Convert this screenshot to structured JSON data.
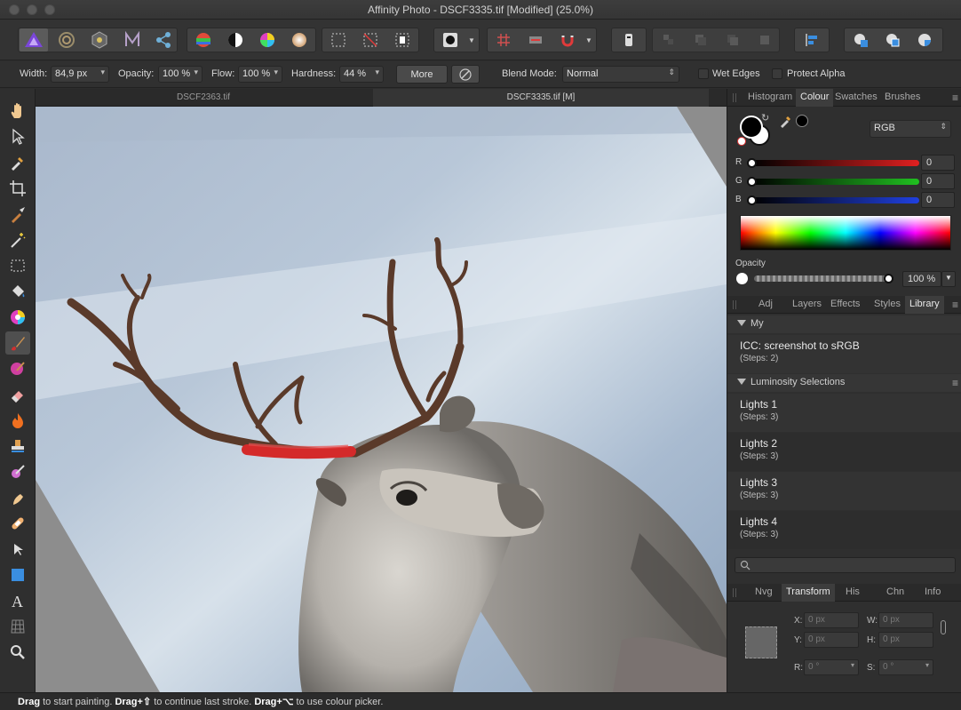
{
  "window": {
    "title": "Affinity Photo - DSCF3335.tif [Modified] (25.0%)"
  },
  "context_bar": {
    "width_label": "Width:",
    "width_value": "84,9 px",
    "opacity_label": "Opacity:",
    "opacity_value": "100 %",
    "flow_label": "Flow:",
    "flow_value": "100 %",
    "hardness_label": "Hardness:",
    "hardness_value": "44 %",
    "more_label": "More",
    "blend_label": "Blend Mode:",
    "blend_value": "Normal",
    "wet_edges_label": "Wet Edges",
    "protect_alpha_label": "Protect Alpha"
  },
  "doc_tabs": [
    {
      "label": "DSCF2363.tif"
    },
    {
      "label": "DSCF3335.tif [M]"
    }
  ],
  "colour_panel": {
    "tabs": [
      "Histogram",
      "Colour",
      "Swatches",
      "Brushes"
    ],
    "active_tab": "Colour",
    "model": "RGB",
    "r_label": "R",
    "r_value": "0",
    "g_label": "G",
    "g_value": "0",
    "b_label": "B",
    "b_value": "0",
    "opacity_label": "Opacity",
    "opacity_value": "100 %"
  },
  "library_panel": {
    "tabs": [
      "Adj",
      "Layers",
      "Effects",
      "Styles",
      "Library"
    ],
    "active_tab": "Library",
    "groups": [
      {
        "name": "My",
        "items": [
          {
            "name": "ICC: screenshot to sRGB",
            "steps": "(Steps: 2)"
          }
        ]
      },
      {
        "name": "Luminosity Selections",
        "items": [
          {
            "name": "Lights 1",
            "steps": "(Steps: 3)"
          },
          {
            "name": "Lights 2",
            "steps": "(Steps: 3)"
          },
          {
            "name": "Lights 3",
            "steps": "(Steps: 3)"
          },
          {
            "name": "Lights 4",
            "steps": "(Steps: 3)"
          }
        ]
      }
    ]
  },
  "transform_panel": {
    "tabs": [
      "Nvg",
      "Transform",
      "His",
      "Chn",
      "Info"
    ],
    "active_tab": "Transform",
    "x_label": "X:",
    "x_value": "0 px",
    "y_label": "Y:",
    "y_value": "0 px",
    "w_label": "W:",
    "w_value": "0 px",
    "h_label": "H:",
    "h_value": "0 px",
    "r_label": "R:",
    "r_value": "0 °",
    "s_label": "S:",
    "s_value": "0 °"
  },
  "status_bar": {
    "drag": "Drag",
    "t1": " to start painting. ",
    "drag_shift": "Drag+⇧",
    "t2": " to continue last stroke. ",
    "drag_alt": "Drag+⌥",
    "t3": " to use colour picker."
  },
  "colors": {
    "brush_stroke": "#d42a2a",
    "active_persona": "#6a3cc8"
  }
}
